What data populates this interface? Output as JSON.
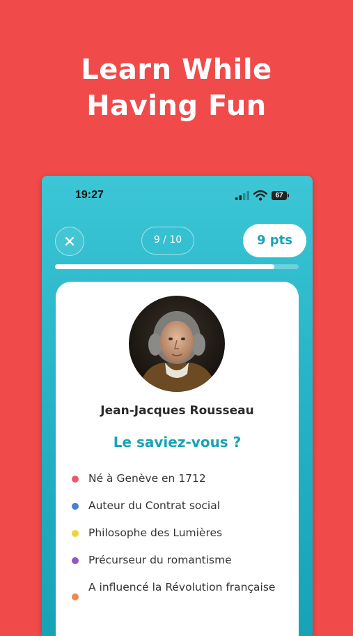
{
  "promo": {
    "line1": "Learn While",
    "line2": "Having Fun"
  },
  "status_bar": {
    "time": "19:27",
    "battery": "67"
  },
  "quiz_header": {
    "close_icon": "close-icon",
    "progress_label": "9 / 10",
    "progress_fraction": 0.9,
    "points_label": "9 pts"
  },
  "card": {
    "name": "Jean-Jacques Rousseau",
    "subtitle": "Le saviez-vous ?",
    "facts": [
      {
        "text": "Né à Genève en 1712",
        "color": "#ec5b63"
      },
      {
        "text": "Auteur du Contrat social",
        "color": "#4d7fd6"
      },
      {
        "text": "Philosophe des Lumières",
        "color": "#f2d336"
      },
      {
        "text": "Précurseur du romantisme",
        "color": "#9456c1"
      },
      {
        "text": "A influencé la Révolution française",
        "color": "#f0894a"
      }
    ]
  },
  "colors": {
    "background": "#f04a4a",
    "accent": "#17a3b6"
  }
}
